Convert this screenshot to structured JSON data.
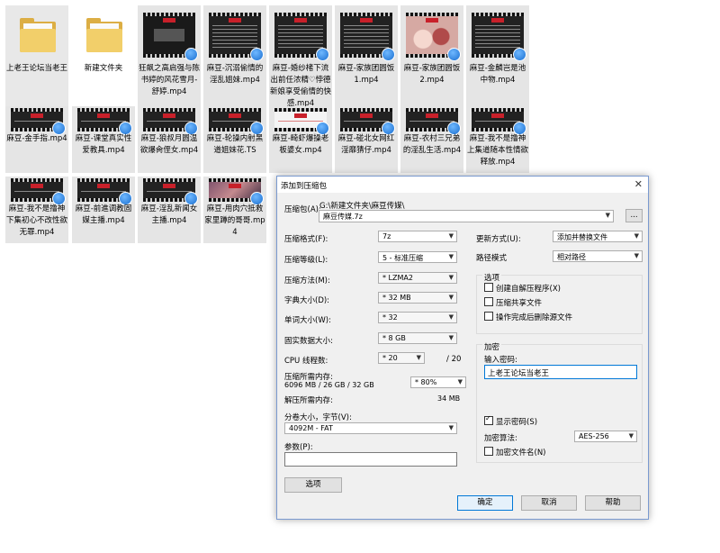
{
  "files": [
    {
      "name": "上老王论坛当老王",
      "kind": "folder"
    },
    {
      "name": "新建文件夹",
      "kind": "folder"
    },
    {
      "name": "狂飙之高启强与陈书婷的风花雪月-舒婷.mp4",
      "kind": "video",
      "style": "dark"
    },
    {
      "name": "麻豆-沉溺偷情的淫乱姐妹.mp4",
      "kind": "video",
      "style": "std"
    },
    {
      "name": "麻豆-婚纱楮下流出前任浓精♡悖德新娘享受偷情的快感.mp4",
      "kind": "video",
      "style": "std"
    },
    {
      "name": "麻豆-家族团圆饭1.mp4",
      "kind": "video",
      "style": "std"
    },
    {
      "name": "麻豆-家族团圆饭2.mp4",
      "kind": "video",
      "style": "pink"
    },
    {
      "name": "麻豆-金麟岂是池中物.mp4",
      "kind": "video",
      "style": "std"
    },
    {
      "name": "麻豆-金手指.mp4",
      "kind": "video",
      "style": "std"
    },
    {
      "name": "麻豆-课堂真实性爱教具.mp4",
      "kind": "video",
      "style": "std"
    },
    {
      "name": "麻豆-狼叔月圆温欲爆肏侄女.mp4",
      "kind": "video",
      "style": "std"
    },
    {
      "name": "麻豆-轮操内射黑道姐妹花.TS",
      "kind": "video",
      "style": "std"
    },
    {
      "name": "麻豆-畸虾爆操老板婆女.mp4",
      "kind": "video",
      "style": "white"
    },
    {
      "name": "麻豆-碰北女网红淫靡猜仔.mp4",
      "kind": "video",
      "style": "std"
    },
    {
      "name": "麻豆-农村三兄弟的淫乱生活.mp4",
      "kind": "video",
      "style": "std"
    },
    {
      "name": "麻豆-我不是撸神上集道随本性情欲释放.mp4",
      "kind": "video",
      "style": "std"
    },
    {
      "name": "麻豆-我不是撸神下集初心不改性欲无罪.mp4",
      "kind": "video",
      "style": "std"
    },
    {
      "name": "麻豆-前進调教固媒主播.mp4",
      "kind": "video",
      "style": "std"
    },
    {
      "name": "麻豆-淫乱新闻女主播.mp4",
      "kind": "video",
      "style": "std"
    },
    {
      "name": "麻豆-用肉穴抵救家里蹲的哥哥.mp4",
      "kind": "video",
      "style": "photo"
    }
  ],
  "dialog": {
    "title": "添加到压缩包",
    "close_glyph": "✕",
    "archive_label": "压缩包(A):",
    "archive_path": "G:\\新建文件夹\\麻豆传媒\\",
    "archive_name": "麻豆传媒.7z",
    "browse_label": "...",
    "rows": [
      {
        "label": "压缩格式(F):",
        "value": "7z"
      },
      {
        "label": "压缩等级(L):",
        "value": "5 - 标准压缩"
      },
      {
        "label": "压缩方法(M):",
        "value": "* LZMA2"
      },
      {
        "label": "字典大小(D):",
        "value": "* 32 MB"
      },
      {
        "label": "单词大小(W):",
        "value": "* 32"
      },
      {
        "label": "固实数据大小:",
        "value": "* 8 GB"
      },
      {
        "label": "CPU 线程数:",
        "value": "* 20",
        "extra": "/ 20"
      }
    ],
    "mem_compress_label": "压缩所需内存:",
    "mem_compress_value": "6096 MB / 26 GB / 32 GB",
    "mem_percent": "* 80%",
    "mem_decompress_label": "解压所需内存:",
    "mem_decompress_value": "34 MB",
    "split_label": "分卷大小，字节(V):",
    "split_value": "4092M - FAT",
    "params_label": "参数(P):",
    "params_value": "",
    "options_button": "选项",
    "update_label": "更新方式(U):",
    "update_value": "添加并替换文件",
    "path_label": "路径模式",
    "path_value": "相对路径",
    "options_group": "选项",
    "options": [
      {
        "label": "创建自解压程序(X)",
        "checked": false
      },
      {
        "label": "压缩共享文件",
        "checked": false
      },
      {
        "label": "操作完成后删除源文件",
        "checked": false
      }
    ],
    "encrypt_group": "加密",
    "password_label": "输入密码:",
    "password_value": "上老王论坛当老王",
    "show_password": "显示密码(S)",
    "show_password_checked": true,
    "algo_label": "加密算法:",
    "algo_value": "AES-256",
    "encrypt_names": "加密文件名(N)",
    "encrypt_names_checked": false,
    "ok_label": "确定",
    "cancel_label": "取消",
    "help_label": "帮助"
  }
}
